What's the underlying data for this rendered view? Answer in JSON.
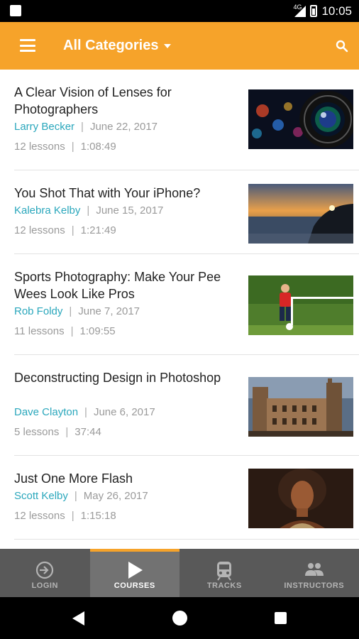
{
  "status": {
    "network": "4G",
    "time": "10:05"
  },
  "appbar": {
    "category_label": "All Categories"
  },
  "courses": [
    {
      "title": "A Clear Vision of Lenses for Photographers",
      "author": "Larry Becker",
      "date": "June 22, 2017",
      "lessons": "12 lessons",
      "duration": "1:08:49"
    },
    {
      "title": "You Shot That with Your iPhone?",
      "author": "Kalebra Kelby",
      "date": "June 15, 2017",
      "lessons": "12 lessons",
      "duration": "1:21:49"
    },
    {
      "title": "Sports Photography: Make Your Pee Wees Look Like Pros",
      "author": "Rob Foldy",
      "date": "June 7, 2017",
      "lessons": "11 lessons",
      "duration": "1:09:55"
    },
    {
      "title": "Deconstructing Design in Photoshop",
      "author": "Dave Clayton",
      "date": "June 6, 2017",
      "lessons": "5 lessons",
      "duration": "37:44"
    },
    {
      "title": "Just One More Flash",
      "author": "Scott Kelby",
      "date": "May 26, 2017",
      "lessons": "12 lessons",
      "duration": "1:15:18"
    }
  ],
  "bottom_nav": [
    {
      "label": "LOGIN",
      "icon": "login-icon",
      "active": false
    },
    {
      "label": "COURSES",
      "icon": "play-icon",
      "active": true
    },
    {
      "label": "TRACKS",
      "icon": "tracks-icon",
      "active": false
    },
    {
      "label": "INSTRUCTORS",
      "icon": "people-icon",
      "active": false
    }
  ],
  "colors": {
    "accent": "#f6a32a",
    "author_link": "#2aa7bc",
    "nav_bg": "#595959",
    "nav_active": "#727272"
  }
}
